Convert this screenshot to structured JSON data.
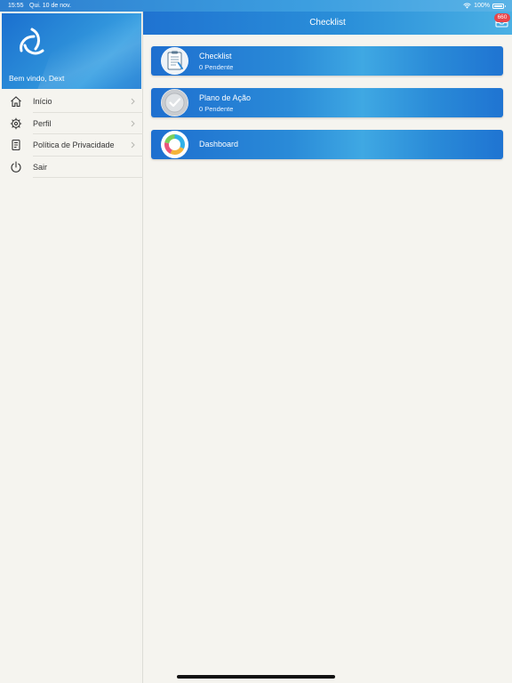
{
  "status_bar": {
    "time": "15:55",
    "date": "Qui. 10 de nov.",
    "battery": "100%"
  },
  "sidebar": {
    "welcome": "Bem vindo, Dext",
    "items": [
      {
        "label": "Início",
        "icon": "home-icon",
        "has_chevron": true
      },
      {
        "label": "Perfil",
        "icon": "gear-icon",
        "has_chevron": true
      },
      {
        "label": "Política de Privacidade",
        "icon": "document-icon",
        "has_chevron": true
      },
      {
        "label": "Sair",
        "icon": "power-icon",
        "has_chevron": false
      }
    ]
  },
  "header": {
    "title": "Checklist",
    "badge": "660"
  },
  "cards": [
    {
      "title": "Checklist",
      "subtitle": "0 Pendente",
      "icon": "clipboard-icon"
    },
    {
      "title": "Plano de Ação",
      "subtitle": "0 Pendente",
      "icon": "check-circle-icon"
    },
    {
      "title": "Dashboard",
      "subtitle": "",
      "icon": "dashboard-ring-icon"
    }
  ],
  "colors": {
    "brand_blue": "#2a8bd8",
    "badge_red": "#e8454a",
    "background": "#f5f4ef"
  }
}
